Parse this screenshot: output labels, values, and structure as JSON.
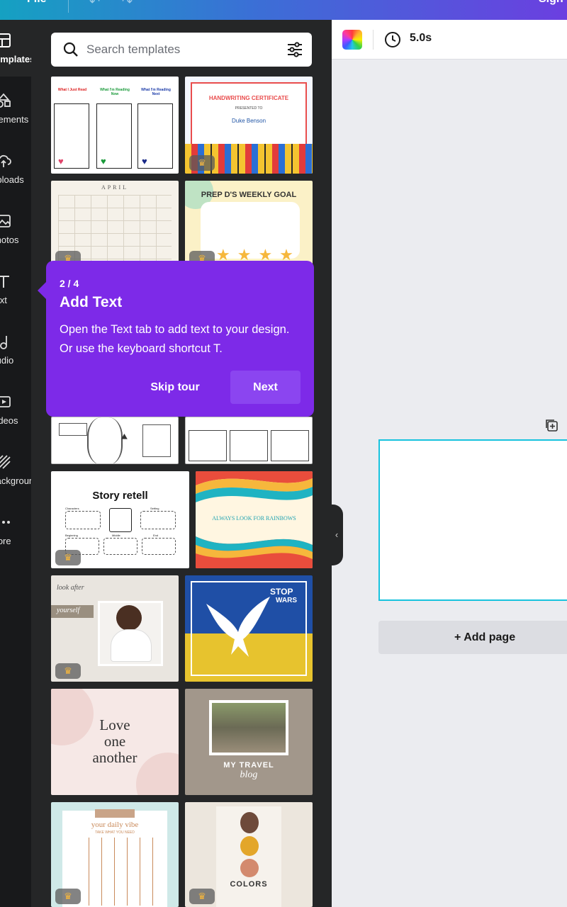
{
  "topbar": {
    "file_label": "File",
    "sign_in_label": "Sign in"
  },
  "rail": {
    "items": [
      {
        "label": "Templates",
        "icon": "layout-icon"
      },
      {
        "label": "Elements",
        "icon": "shapes-icon"
      },
      {
        "label": "Uploads",
        "icon": "cloud-upload-icon"
      },
      {
        "label": "Photos",
        "icon": "image-icon"
      },
      {
        "label": "Text",
        "icon": "text-icon"
      },
      {
        "label": "Audio",
        "icon": "music-note-icon"
      },
      {
        "label": "Videos",
        "icon": "video-icon"
      },
      {
        "label": "Background",
        "icon": "stripes-icon"
      },
      {
        "label": "More",
        "icon": "more-dots-icon"
      }
    ]
  },
  "search": {
    "placeholder": "Search templates"
  },
  "templates": {
    "t1": {
      "a": "What I Just Read",
      "b": "What I'm Reading Now",
      "c": "What I'm Reading Next"
    },
    "t2": {
      "title": "HANDWRITING CERTIFICATE",
      "presented": "PRESENTED TO",
      "name": "Duke Benson"
    },
    "t3": {
      "month": "APRIL"
    },
    "t4": {
      "title": "PREP D'S WEEKLY GOAL"
    },
    "t7": {
      "title": "Story retell",
      "chars": "Characters",
      "setting": "Setting",
      "beginning": "Beginning",
      "middle": "Middle",
      "end": "End"
    },
    "t8": {
      "text": "ALWAYS LOOK FOR RAINBOWS"
    },
    "t9": {
      "a": "look after",
      "b": "yourself"
    },
    "t10": {
      "a": "STOP",
      "b": "WARS"
    },
    "t11": {
      "a": "Love",
      "b": "one",
      "c": "another"
    },
    "t12": {
      "a": "MY TRAVEL",
      "b": "blog"
    },
    "t13": {
      "a": "your daily vibe",
      "b": "TAKE WHAT YOU NEED"
    },
    "t14": {
      "a": "COLORS"
    }
  },
  "toolbar": {
    "duration": "5.0s"
  },
  "canvas": {
    "add_page_label": "+ Add page"
  },
  "tooltip": {
    "step": "2 / 4",
    "title": "Add Text",
    "body": "Open the Text tab to add text to your design. Or use the keyboard shortcut T.",
    "skip_label": "Skip tour",
    "next_label": "Next"
  },
  "colors": {
    "accent": "#7d2ae8",
    "selection": "#18c3de",
    "crown": "#f6b73c"
  }
}
